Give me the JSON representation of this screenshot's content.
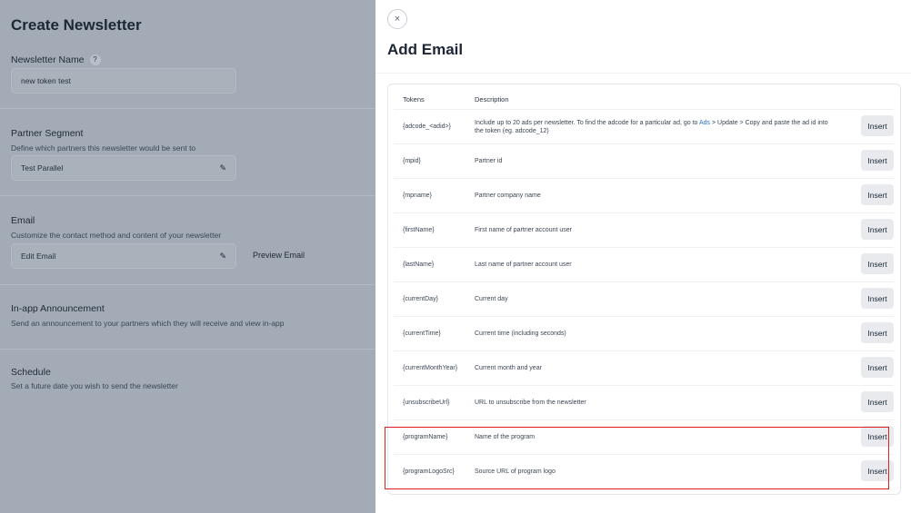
{
  "left": {
    "title": "Create Newsletter",
    "newsletter_name_label": "Newsletter Name",
    "help_badge": "?",
    "newsletter_name_value": "new token test",
    "partner_segment_label": "Partner Segment",
    "partner_segment_desc": "Define which partners this newsletter would be sent to",
    "partner_segment_value": "Test Parallel",
    "email_label": "Email",
    "email_desc": "Customize the contact method and content of your newsletter",
    "email_value": "Edit Email",
    "preview_email": "Preview Email",
    "inapp_label": "In-app Announcement",
    "inapp_desc": "Send an announcement to your partners which they will receive and view in-app",
    "schedule_label": "Schedule",
    "schedule_desc": "Set a future date you wish to send the newsletter"
  },
  "panel": {
    "close_glyph": "×",
    "title": "Add Email",
    "table": {
      "col_tokens": "Tokens",
      "col_description": "Description",
      "insert_label": "Insert",
      "first_row": {
        "token": "{adcode_<adid>}",
        "desc_before": "Include up to 20 ads per newsletter. To find the adcode for a particular ad, go to ",
        "desc_link": "Ads",
        "desc_after": " > Update > Copy and paste the ad id into the token (eg. adcode_12)"
      },
      "rows": [
        {
          "token": "{mpid}",
          "desc": "Partner id"
        },
        {
          "token": "{mpname}",
          "desc": "Partner company name"
        },
        {
          "token": "{firstName}",
          "desc": "First name of partner account user"
        },
        {
          "token": "{lastName}",
          "desc": "Last name of partner account user"
        },
        {
          "token": "{currentDay}",
          "desc": "Current day"
        },
        {
          "token": "{currentTime}",
          "desc": "Current time (including seconds)"
        },
        {
          "token": "{currentMonthYear}",
          "desc": "Current month and year"
        },
        {
          "token": "{unsubscribeUrl}",
          "desc": "URL to unsubscribe from the newsletter"
        },
        {
          "token": "{programName}",
          "desc": "Name of the program"
        },
        {
          "token": "{programLogoSrc}",
          "desc": "Source URL of program logo"
        }
      ]
    }
  },
  "colors": {
    "highlight": "#e02020",
    "link": "#2b6fd6",
    "dim_overlay": "#a3abb6"
  }
}
